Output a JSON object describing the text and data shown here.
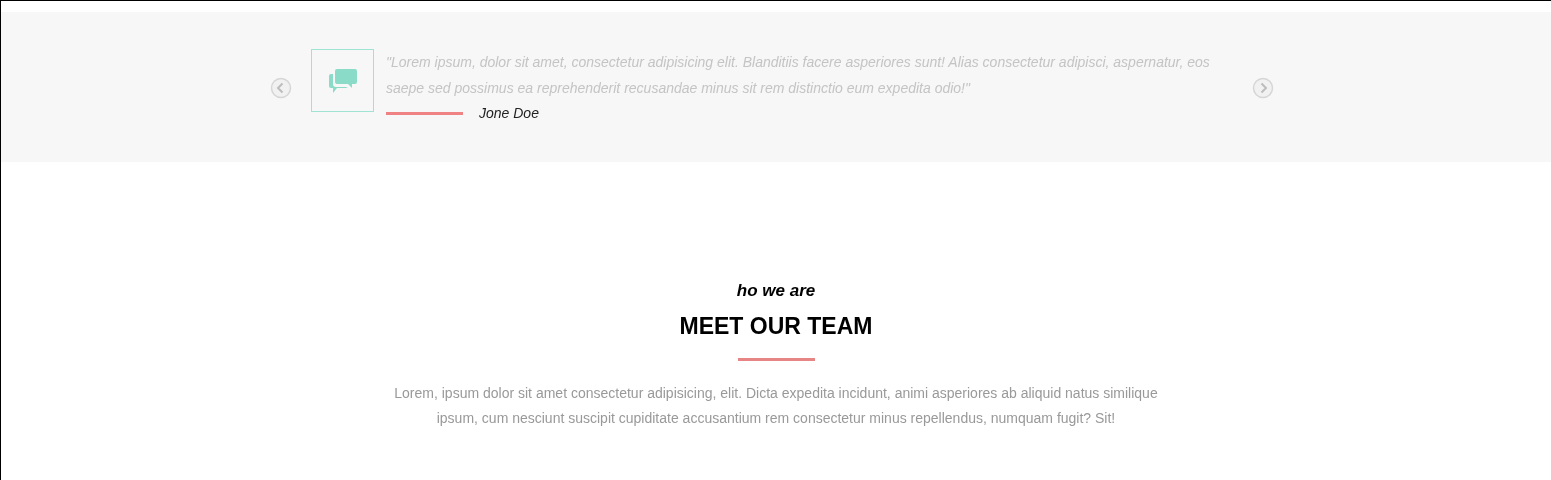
{
  "testimonial": {
    "quote": "\"Lorem ipsum, dolor sit amet, consectetur adipisicing elit. Blanditiis facere asperiores sunt! Alias consectetur adipisci, aspernatur, eos saepe sed possimus ea reprehenderit recusandae minus sit rem distinctio eum expedita odio!\"",
    "author": "Jone Doe"
  },
  "team": {
    "kicker": "ho we are",
    "title": "MEET OUR TEAM",
    "description": "Lorem, ipsum dolor sit amet consectetur adipisicing, elit. Dicta expedita incidunt, animi asperiores ab aliquid natus similique ipsum, cum nesciunt suscipit cupiditate accusantium rem consectetur minus repellendus, numquam fugit? Sit!"
  }
}
